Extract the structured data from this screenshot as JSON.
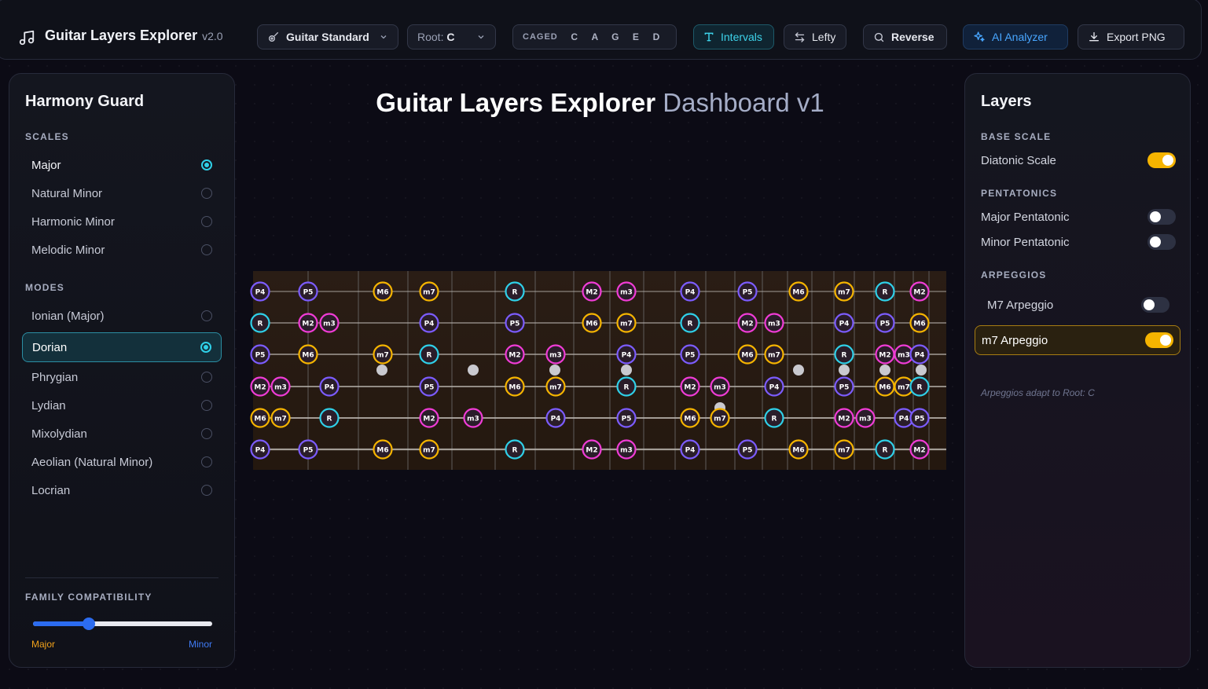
{
  "app": {
    "title": "Guitar Layers Explorer",
    "version": "v2.0"
  },
  "toolbar": {
    "tuning": "Guitar Standard",
    "root_label": "Root:",
    "root_value": "C",
    "caged_label": "CAGED",
    "caged_letters": [
      "C",
      "A",
      "G",
      "E",
      "D"
    ],
    "intervals_label": "Intervals",
    "lefty_label": "Lefty",
    "reverse_label": "Reverse",
    "ai_label": "AI Analyzer",
    "export_label": "Export PNG"
  },
  "left_panel": {
    "title": "Harmony Guard",
    "scales_label": "SCALES",
    "scales": [
      {
        "label": "Major",
        "selected": true
      },
      {
        "label": "Natural Minor",
        "selected": false
      },
      {
        "label": "Harmonic Minor",
        "selected": false
      },
      {
        "label": "Melodic Minor",
        "selected": false
      }
    ],
    "modes_label": "MODES",
    "modes": [
      {
        "label": "Ionian (Major)",
        "selected": false
      },
      {
        "label": "Dorian",
        "selected": true
      },
      {
        "label": "Phrygian",
        "selected": false
      },
      {
        "label": "Lydian",
        "selected": false
      },
      {
        "label": "Mixolydian",
        "selected": false
      },
      {
        "label": "Aeolian (Natural Minor)",
        "selected": false
      },
      {
        "label": "Locrian",
        "selected": false
      }
    ],
    "family_label": "FAMILY COMPATIBILITY",
    "family_value": 0.31,
    "family_min": "Major",
    "family_max": "Minor"
  },
  "main": {
    "title": "Guitar Layers Explorer",
    "subtitle": "Dashboard v1"
  },
  "right_panel": {
    "title": "Layers",
    "base_label": "BASE SCALE",
    "base_item": {
      "label": "Diatonic Scale",
      "on": true
    },
    "pent_label": "PENTATONICS",
    "pent_items": [
      {
        "label": "Major Pentatonic",
        "on": false
      },
      {
        "label": "Minor Pentatonic",
        "on": false
      }
    ],
    "arp_label": "ARPEGGIOS",
    "arp_items": [
      {
        "label": "M7 Arpeggio",
        "on": false
      },
      {
        "label": "m7 Arpeggio",
        "on": true
      }
    ],
    "note": "Arpeggios adapt to Root: C"
  },
  "colors": {
    "R": "#2fd0e8",
    "P4": "#7c5cff",
    "P5": "#7c5cff",
    "M2": "#f03cd6",
    "m3": "#f03cd6",
    "M6": "#f5b400",
    "m7": "#f5b400"
  },
  "fretboard": {
    "strings": [
      [
        "P4",
        null,
        "P5",
        null,
        "M6",
        "m7",
        null,
        "R",
        null,
        "M2",
        "m3",
        null,
        "P4",
        null,
        "P5",
        null,
        "M6",
        "m7",
        null,
        "R",
        null,
        "M2"
      ],
      [
        "R",
        null,
        "M2",
        "m3",
        null,
        "P4",
        null,
        "P5",
        null,
        "M6",
        "m7",
        null,
        "R",
        null,
        "M2",
        "m3",
        null,
        "P4",
        null,
        "P5",
        null,
        "M6"
      ],
      [
        "P5",
        null,
        "M6",
        null,
        "m7",
        "R",
        null,
        "M2",
        "m3",
        null,
        "P4",
        null,
        "P5",
        null,
        "M6",
        "m7",
        null,
        "R",
        null,
        "M2",
        "m3",
        "P4"
      ],
      [
        "M2",
        "m3",
        null,
        "P4",
        null,
        "P5",
        null,
        "M6",
        "m7",
        null,
        "R",
        null,
        "M2",
        "m3",
        null,
        "P4",
        null,
        "P5",
        null,
        "M6",
        "m7",
        "R"
      ],
      [
        "M6",
        "m7",
        null,
        "R",
        null,
        "M2",
        "m3",
        null,
        "P4",
        null,
        "P5",
        null,
        "M6",
        "m7",
        null,
        "R",
        null,
        "M2",
        "m3",
        null,
        "P4",
        "P5"
      ],
      [
        "P4",
        null,
        "P5",
        null,
        "M6",
        "m7",
        null,
        "R",
        null,
        "M2",
        "m3",
        null,
        "P4",
        null,
        "P5",
        null,
        "M6",
        "m7",
        null,
        "R",
        null,
        "M2"
      ]
    ],
    "inlay_frets": [
      3,
      5,
      7,
      9,
      12,
      15,
      17,
      19,
      21
    ]
  }
}
